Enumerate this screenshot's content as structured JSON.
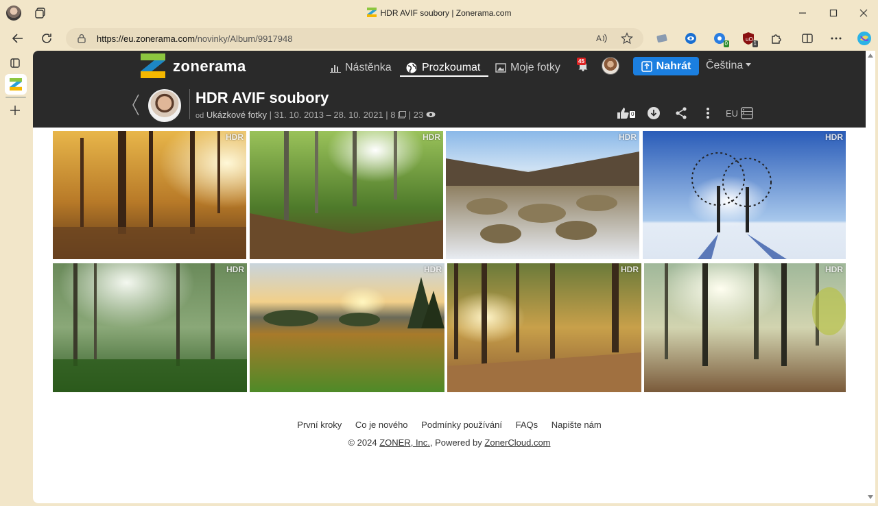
{
  "browser": {
    "window_title": "HDR AVIF soubory | Zonerama.com",
    "url_host": "https://eu.zonerama.com",
    "url_path": "/novinky/Album/9917948",
    "extension_badges": [
      "0",
      "1"
    ]
  },
  "site": {
    "logo_text": "zonerama",
    "nav": [
      {
        "label": "Nástěnka",
        "icon": "chart-icon"
      },
      {
        "label": "Prozkoumat",
        "icon": "globe-icon"
      },
      {
        "label": "Moje fotky",
        "icon": "photos-icon"
      }
    ],
    "notification_count": "45",
    "upload_label": "Nahrát",
    "language": "Čeština"
  },
  "album": {
    "title": "HDR AVIF soubory",
    "by_prefix": "od",
    "owner": "Ukázkové fotky",
    "date_range": "| 31. 10. 2013 – 28. 10. 2021 |",
    "photo_count": "8",
    "view_count": "| 23",
    "like_count": "0",
    "region": "EU"
  },
  "photos": [
    {
      "badge": "HDR",
      "subject": "autumn-forest-sun"
    },
    {
      "badge": "HDR",
      "subject": "green-forest-path"
    },
    {
      "badge": "HDR",
      "subject": "snowy-meadow-grass"
    },
    {
      "badge": "HDR",
      "subject": "trees-winter-field"
    },
    {
      "badge": "HDR",
      "subject": "foggy-forest-rays"
    },
    {
      "badge": "HDR",
      "subject": "meadow-sunset"
    },
    {
      "badge": "HDR",
      "subject": "pine-forest-sunrise"
    },
    {
      "badge": "HDR",
      "subject": "misty-forest-light"
    }
  ],
  "footer": {
    "links": [
      "První kroky",
      "Co je nového",
      "Podmínky používání",
      "FAQs",
      "Napište nám"
    ],
    "copyright_prefix": "© 2024",
    "company": "ZONER, Inc.",
    "powered_prefix": ", Powered by",
    "powered_link": "ZonerCloud.com"
  }
}
